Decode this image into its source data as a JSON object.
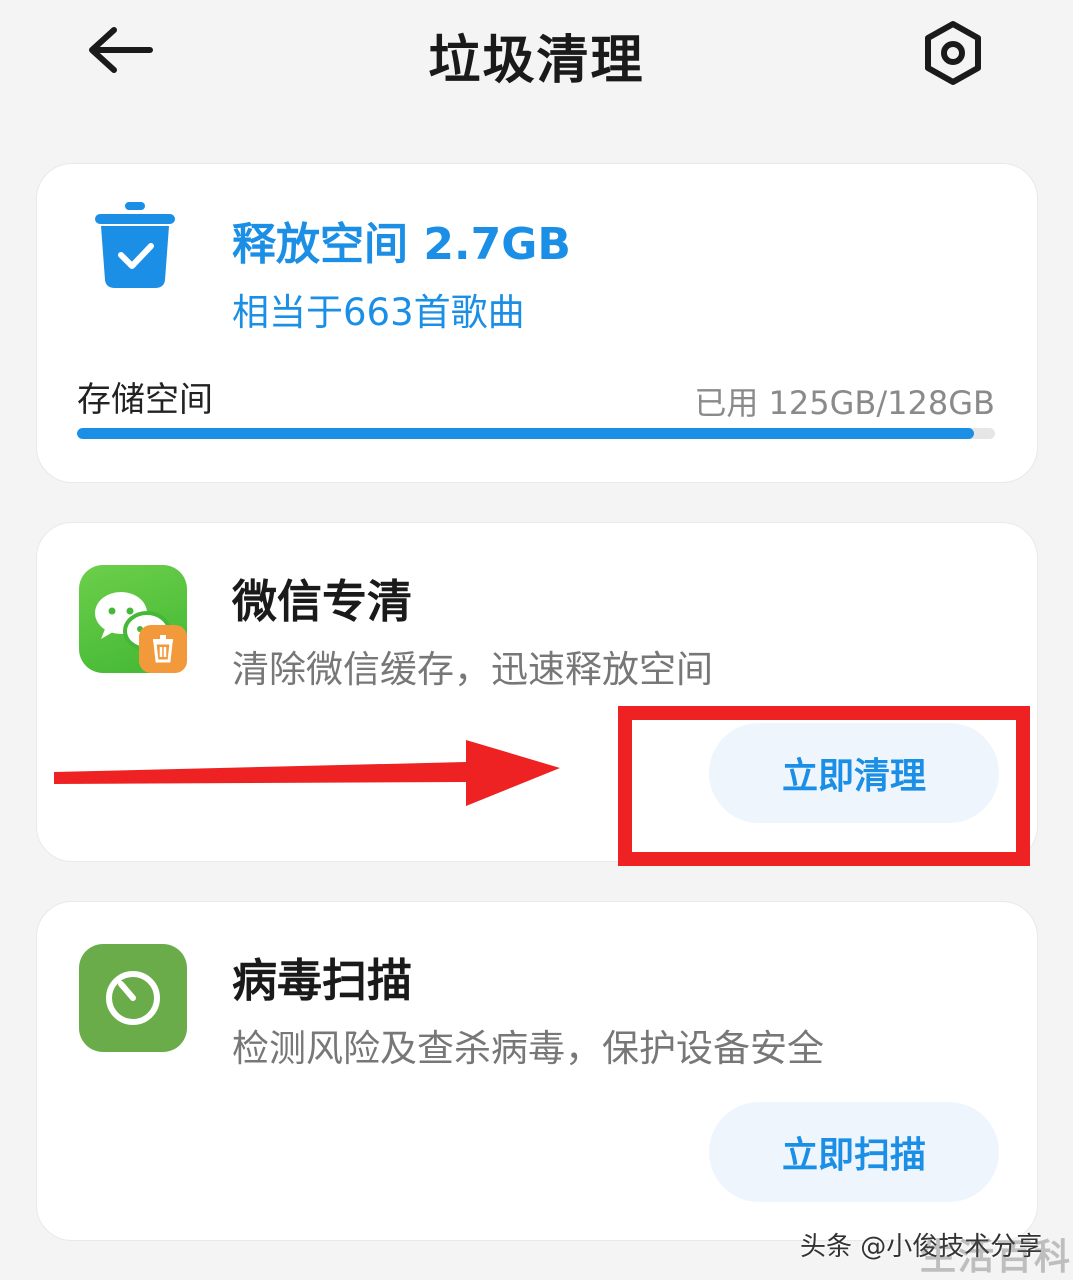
{
  "header": {
    "title": "垃圾清理"
  },
  "storage_card": {
    "free_title": "释放空间 2.7GB",
    "free_subtitle": "相当于663首歌曲",
    "storage_label": "存储空间",
    "used_text": "已用 125GB/128GB",
    "used_fraction": 0.977
  },
  "wechat_card": {
    "title": "微信专清",
    "description": "清除微信缓存，迅速释放空间",
    "action_label": "立即清理"
  },
  "virus_card": {
    "title": "病毒扫描",
    "description": "检测风险及查杀病毒，保护设备安全",
    "action_label": "立即扫描"
  },
  "watermark": {
    "source": "头条 @小俊技术分享",
    "brand": "生活百科"
  },
  "colors": {
    "accent": "#1b8fe6",
    "annotation": "#ee2222"
  }
}
